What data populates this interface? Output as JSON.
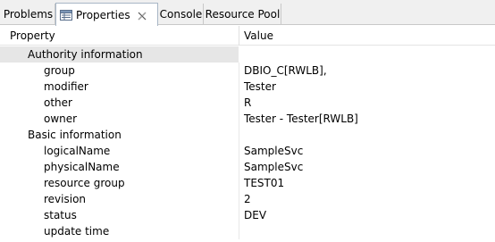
{
  "tabs": [
    {
      "label": "Problems"
    },
    {
      "label": "Properties"
    },
    {
      "label": "Console"
    },
    {
      "label": "Resource Pool"
    }
  ],
  "table": {
    "columns": [
      "Property",
      "Value"
    ],
    "groups": [
      {
        "label": "Authority information",
        "rows": [
          {
            "property": "group",
            "value": "DBIO_C[RWLB],"
          },
          {
            "property": "modifier",
            "value": "Tester"
          },
          {
            "property": "other",
            "value": "R"
          },
          {
            "property": "owner",
            "value": "Tester - Tester[RWLB]"
          }
        ]
      },
      {
        "label": "Basic information",
        "rows": [
          {
            "property": "logicalName",
            "value": "SampleSvc"
          },
          {
            "property": "physicalName",
            "value": "SampleSvc"
          },
          {
            "property": "resource group",
            "value": "TEST01"
          },
          {
            "property": "revision",
            "value": "2"
          },
          {
            "property": "status",
            "value": "DEV"
          },
          {
            "property": "update time",
            "value": ""
          }
        ]
      }
    ]
  },
  "colors": {
    "selected_row": "#e6e6e6",
    "tab_bar": "#f0f0f0",
    "active_tab_border": "#a8b6c6"
  }
}
